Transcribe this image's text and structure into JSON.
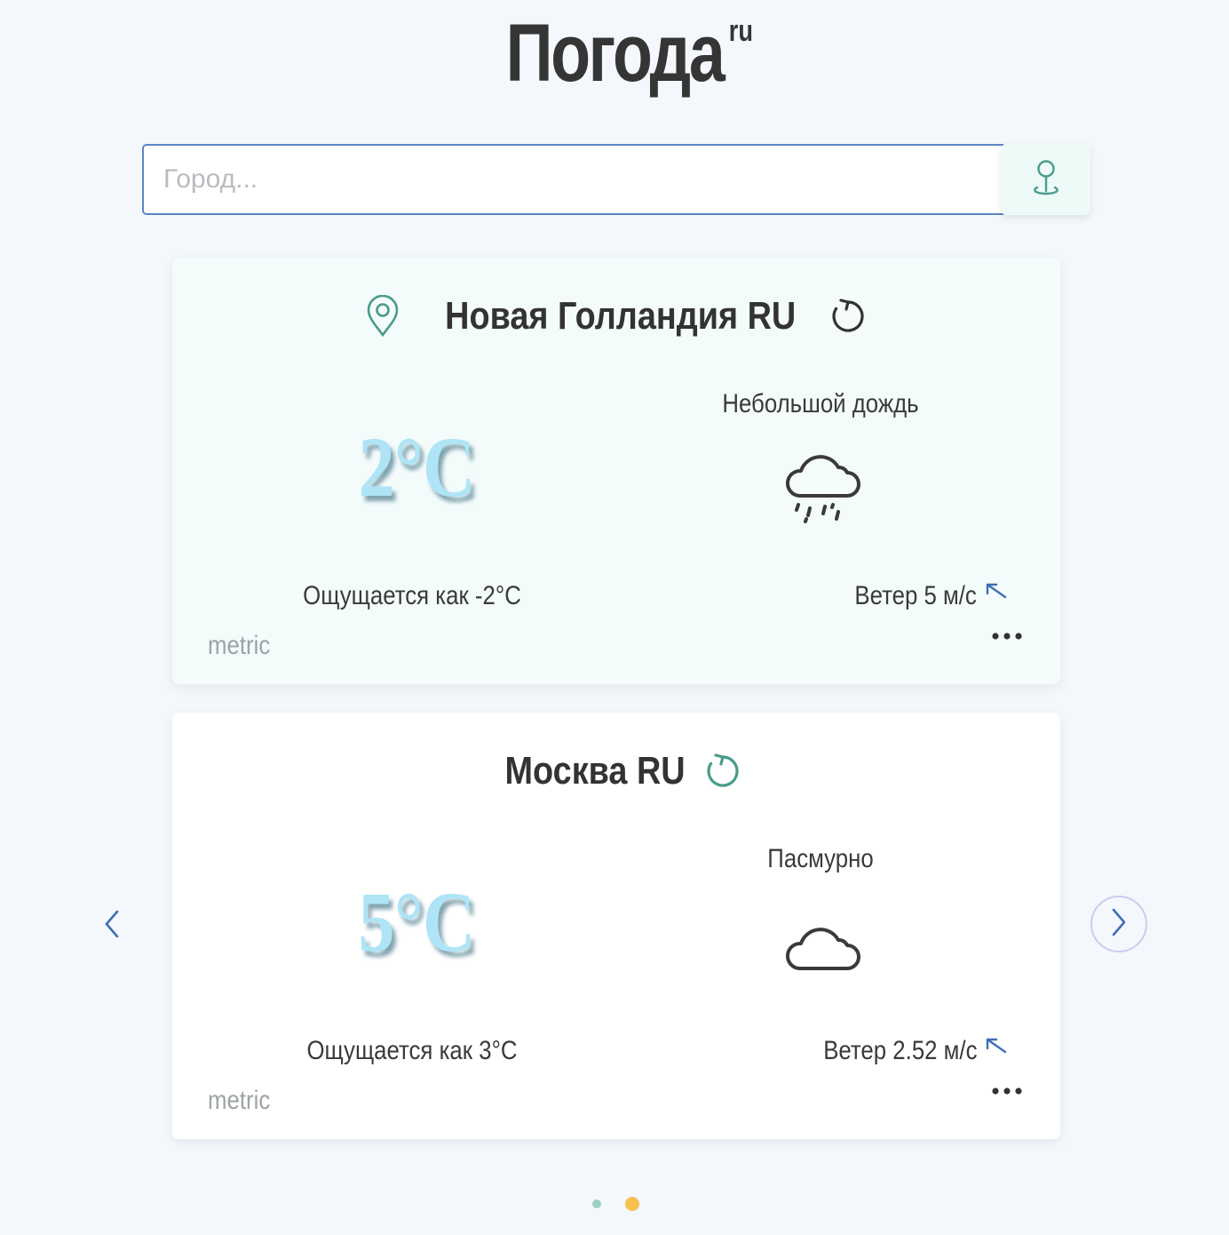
{
  "header": {
    "title": "Погода",
    "title_sup": "ru"
  },
  "search": {
    "placeholder": "Город...",
    "value": "",
    "geo_button_icon": "map-pin-icon"
  },
  "cards": [
    {
      "city": "Новая Голландия RU",
      "has_location_icon": true,
      "temperature": "2°C",
      "condition": "Небольшой дождь",
      "condition_icon": "cloud-rain-icon",
      "feels_like": "Ощущается как -2°C",
      "wind": "Ветер 5 м/с",
      "units": "metric"
    },
    {
      "city": "Москва RU",
      "has_location_icon": false,
      "temperature": "5°C",
      "condition": "Пасмурно",
      "condition_icon": "cloud-icon",
      "feels_like": "Ощущается как 3°C",
      "wind": "Ветер 2.52 м/с",
      "units": "metric"
    }
  ],
  "carousel": {
    "page_count": 2,
    "active_page": 2
  },
  "colors": {
    "accent_green": "#4a9b8a",
    "temperature": "#aee4f6",
    "input_border": "#5b86c2",
    "arrow_blue": "#3f6fb5",
    "active_dot": "#f5c250",
    "inactive_dot": "#9fcfc4"
  }
}
